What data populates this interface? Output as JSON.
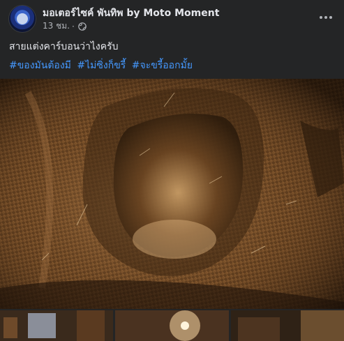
{
  "post": {
    "page_name": "มอเตอร์ไซค์ พันทิพ by Moto Moment",
    "time": "13 ชม.",
    "separator": "·",
    "privacy_icon": "globe-icon",
    "caption": "สายแต่งคาร์บอนว่าไงครับ",
    "hashtags": [
      "#ของมันต้องมี",
      "#ไม่ซิ่งก็ขรี้",
      "#จะขรี้ออกมั้ย"
    ],
    "more_icon": "more-options-icon"
  },
  "photos": {
    "main_alt": "carbon fiber part",
    "thumb_count": 3
  },
  "colors": {
    "background": "#242526",
    "text": "#e4e6eb",
    "secondary": "#b0b3b8",
    "link": "#4599ff"
  }
}
